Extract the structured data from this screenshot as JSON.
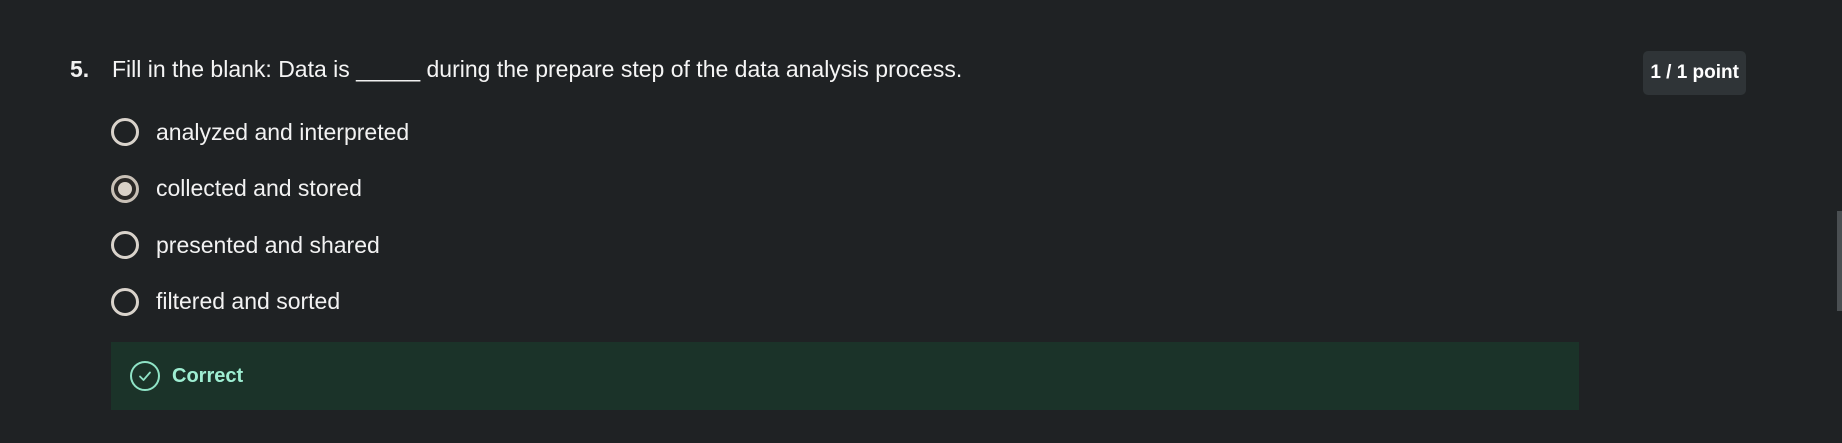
{
  "question": {
    "number": "5.",
    "text": "Fill in the blank: Data is _____ during the prepare step of the data analysis process.",
    "points": "1 / 1 point",
    "selected_index": 1
  },
  "options": [
    {
      "label": "analyzed and interpreted"
    },
    {
      "label": "collected and stored"
    },
    {
      "label": "presented and shared"
    },
    {
      "label": "filtered and sorted"
    }
  ],
  "feedback": {
    "status": "Correct",
    "icon": "check-circle-icon",
    "accent": "#9eeed2",
    "background": "#1b3329"
  }
}
